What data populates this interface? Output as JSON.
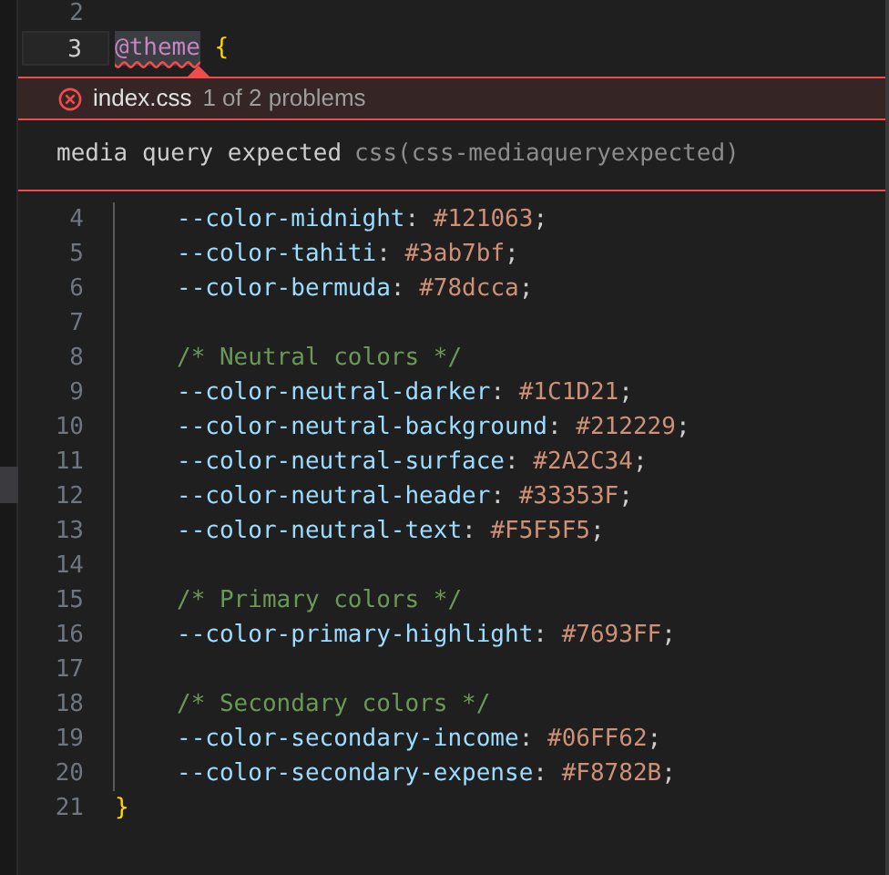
{
  "editor": {
    "lines_above": [
      {
        "number": "2",
        "current": false
      },
      {
        "number": "3",
        "current": true,
        "indented": false,
        "tokens": [
          {
            "kind": "at-rule",
            "text": "@theme",
            "error": true
          },
          {
            "kind": "brace",
            "text": " {"
          }
        ]
      }
    ],
    "problem_peek": {
      "file": "index.css",
      "counter": "1 of 2 problems",
      "message": "media query expected",
      "source": "css(css-mediaqueryexpected)"
    },
    "lines_below": [
      {
        "number": "4",
        "current": false,
        "indented": true,
        "tokens": [
          {
            "kind": "property",
            "text": "--color-midnight"
          },
          {
            "kind": "punct",
            "text": ": "
          },
          {
            "kind": "value",
            "text": "#121063"
          },
          {
            "kind": "punct",
            "text": ";"
          }
        ]
      },
      {
        "number": "5",
        "current": false,
        "indented": true,
        "tokens": [
          {
            "kind": "property",
            "text": "--color-tahiti"
          },
          {
            "kind": "punct",
            "text": ": "
          },
          {
            "kind": "value",
            "text": "#3ab7bf"
          },
          {
            "kind": "punct",
            "text": ";"
          }
        ]
      },
      {
        "number": "6",
        "current": false,
        "indented": true,
        "tokens": [
          {
            "kind": "property",
            "text": "--color-bermuda"
          },
          {
            "kind": "punct",
            "text": ": "
          },
          {
            "kind": "value",
            "text": "#78dcca"
          },
          {
            "kind": "punct",
            "text": ";"
          }
        ]
      },
      {
        "number": "7",
        "current": false,
        "indented": true
      },
      {
        "number": "8",
        "current": false,
        "indented": true,
        "tokens": [
          {
            "kind": "comment",
            "text": "/* Neutral colors */"
          }
        ]
      },
      {
        "number": "9",
        "current": false,
        "indented": true,
        "tokens": [
          {
            "kind": "property",
            "text": "--color-neutral-darker"
          },
          {
            "kind": "punct",
            "text": ": "
          },
          {
            "kind": "value",
            "text": "#1C1D21"
          },
          {
            "kind": "punct",
            "text": ";"
          }
        ]
      },
      {
        "number": "10",
        "current": false,
        "indented": true,
        "tokens": [
          {
            "kind": "property",
            "text": "--color-neutral-background"
          },
          {
            "kind": "punct",
            "text": ": "
          },
          {
            "kind": "value",
            "text": "#212229"
          },
          {
            "kind": "punct",
            "text": ";"
          }
        ]
      },
      {
        "number": "11",
        "current": false,
        "indented": true,
        "tokens": [
          {
            "kind": "property",
            "text": "--color-neutral-surface"
          },
          {
            "kind": "punct",
            "text": ": "
          },
          {
            "kind": "value",
            "text": "#2A2C34"
          },
          {
            "kind": "punct",
            "text": ";"
          }
        ]
      },
      {
        "number": "12",
        "current": false,
        "indented": true,
        "tokens": [
          {
            "kind": "property",
            "text": "--color-neutral-header"
          },
          {
            "kind": "punct",
            "text": ": "
          },
          {
            "kind": "value",
            "text": "#33353F"
          },
          {
            "kind": "punct",
            "text": ";"
          }
        ]
      },
      {
        "number": "13",
        "current": false,
        "indented": true,
        "tokens": [
          {
            "kind": "property",
            "text": "--color-neutral-text"
          },
          {
            "kind": "punct",
            "text": ": "
          },
          {
            "kind": "value",
            "text": "#F5F5F5"
          },
          {
            "kind": "punct",
            "text": ";"
          }
        ]
      },
      {
        "number": "14",
        "current": false,
        "indented": true
      },
      {
        "number": "15",
        "current": false,
        "indented": true,
        "tokens": [
          {
            "kind": "comment",
            "text": "/* Primary colors */"
          }
        ]
      },
      {
        "number": "16",
        "current": false,
        "indented": true,
        "tokens": [
          {
            "kind": "property",
            "text": "--color-primary-highlight"
          },
          {
            "kind": "punct",
            "text": ": "
          },
          {
            "kind": "value",
            "text": "#7693FF"
          },
          {
            "kind": "punct",
            "text": ";"
          }
        ]
      },
      {
        "number": "17",
        "current": false,
        "indented": true
      },
      {
        "number": "18",
        "current": false,
        "indented": true,
        "tokens": [
          {
            "kind": "comment",
            "text": "/* Secondary colors */"
          }
        ]
      },
      {
        "number": "19",
        "current": false,
        "indented": true,
        "tokens": [
          {
            "kind": "property",
            "text": "--color-secondary-income"
          },
          {
            "kind": "punct",
            "text": ": "
          },
          {
            "kind": "value",
            "text": "#06FF62"
          },
          {
            "kind": "punct",
            "text": ";"
          }
        ]
      },
      {
        "number": "20",
        "current": false,
        "indented": true,
        "tokens": [
          {
            "kind": "property",
            "text": "--color-secondary-expense"
          },
          {
            "kind": "punct",
            "text": ": "
          },
          {
            "kind": "value",
            "text": "#F8782B"
          },
          {
            "kind": "punct",
            "text": ";"
          }
        ]
      },
      {
        "number": "21",
        "current": false,
        "indented": false,
        "tokens": [
          {
            "kind": "brace",
            "text": "}"
          }
        ]
      }
    ]
  }
}
